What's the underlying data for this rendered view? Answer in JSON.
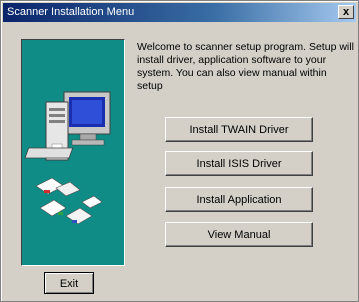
{
  "window": {
    "title": "Scanner Installation Menu",
    "close_glyph": "x"
  },
  "welcome_text": "Welcome to scanner setup program. Setup will install driver, application software to your system. You can also view manual within setup",
  "buttons": {
    "twain": "Install TWAIN Driver",
    "isis": "Install ISIS Driver",
    "application": "Install Application",
    "manual": "View Manual",
    "exit": "Exit"
  },
  "illustration": {
    "name": "computer-with-documents-icon",
    "panel_color": "#0f8c86"
  }
}
